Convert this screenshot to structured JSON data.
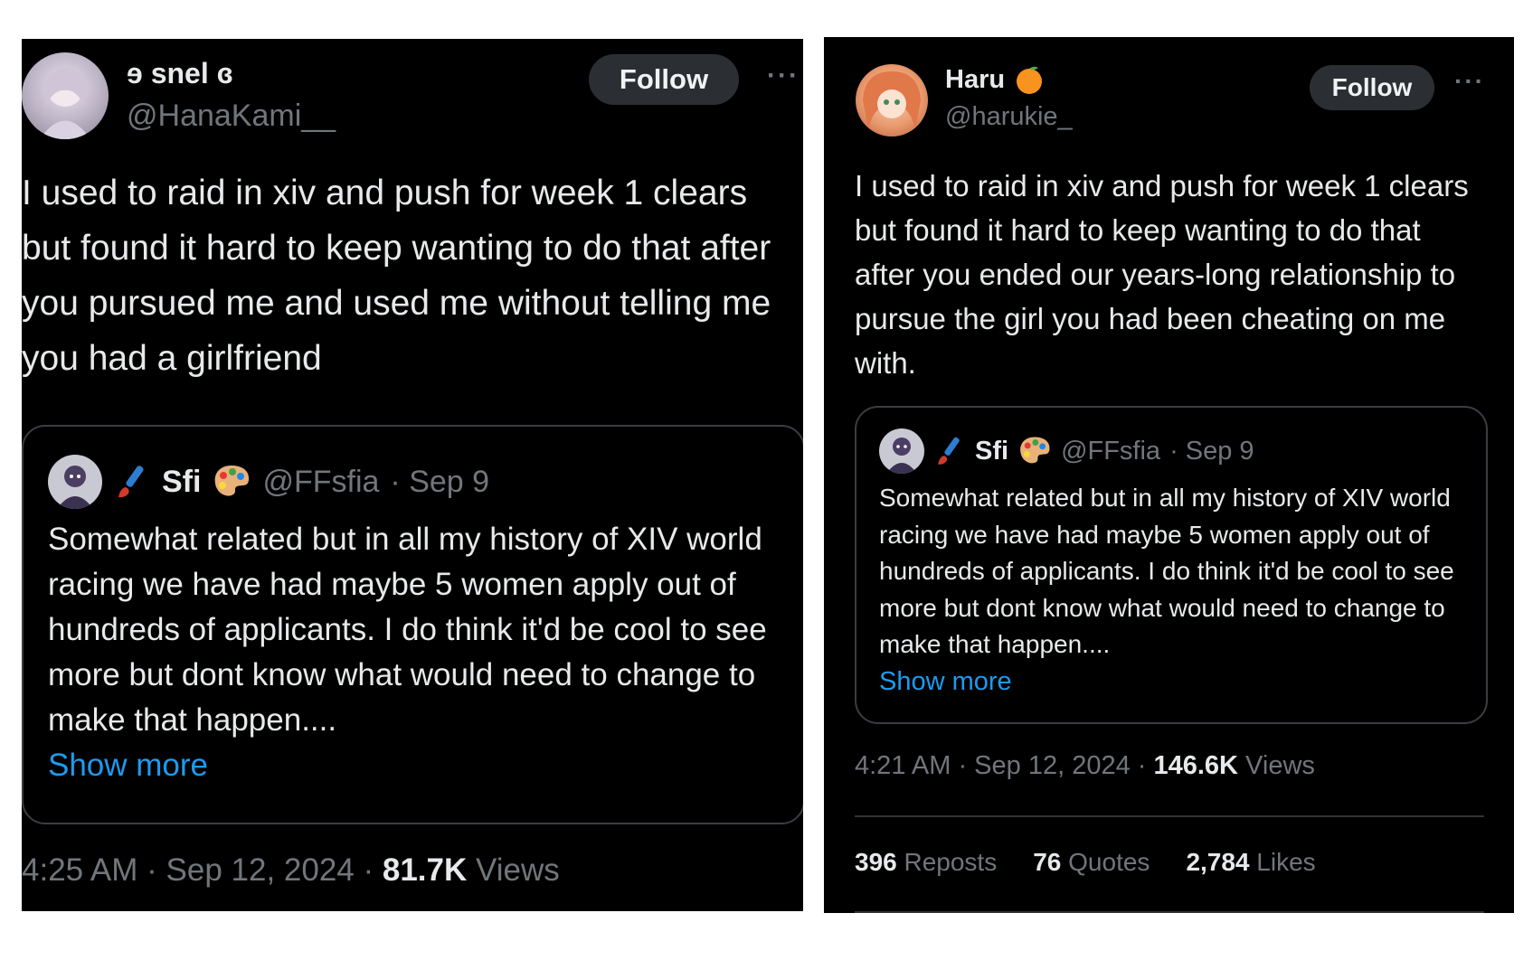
{
  "left": {
    "author": {
      "name": "ɘ snel ɞ",
      "handle": "@HanaKami__"
    },
    "follow_label": "Follow",
    "more_label": "···",
    "body": "I used to raid in xiv and push for week 1 clears but found it hard to keep wanting to do that after you pursued me and used me without telling me you had a girlfriend",
    "quote": {
      "name": "Sfi",
      "handle": "@FFsfia",
      "date": "· Sep 9",
      "text": "Somewhat related but in all my history of XIV world racing we have had maybe 5 women apply out of hundreds of applicants. I do think it'd be cool to see more but dont know what would need to change to make that happen....",
      "show_more": "Show more"
    },
    "meta": {
      "time": "4:25 AM · Sep 12, 2024 · ",
      "views": "81.7K",
      "views_label": " Views"
    }
  },
  "right": {
    "author": {
      "name": "Haru",
      "handle": "@harukie_"
    },
    "follow_label": "Follow",
    "more_label": "···",
    "body": "I used to raid in xiv and push for week 1 clears but found it hard to keep wanting to do that after you ended our years-long relationship to pursue the girl you had been cheating on me with.",
    "quote": {
      "name": "Sfi",
      "handle": "@FFsfia",
      "date": "· Sep 9",
      "text": "Somewhat related but in all my history of XIV world racing we have had maybe 5 women apply out of hundreds of applicants. I do think it'd be cool to see more but dont know what would need to change to make that happen....",
      "show_more": "Show more"
    },
    "meta": {
      "time": "4:21 AM · Sep 12, 2024 · ",
      "views": "146.6K",
      "views_label": " Views"
    },
    "stats": {
      "reposts": "396",
      "reposts_label": " Reposts",
      "quotes": "76",
      "quotes_label": " Quotes",
      "likes": "2,784",
      "likes_label": " Likes"
    }
  },
  "icons": [
    "orange-emoji-icon",
    "paintbrush-icon",
    "palette-icon",
    "more-icon"
  ],
  "colors": {
    "background": "#000000",
    "text": "#e7e9ea",
    "secondary": "#71767b",
    "link": "#1d9bf0",
    "follow_bg": "#2b2f33"
  }
}
